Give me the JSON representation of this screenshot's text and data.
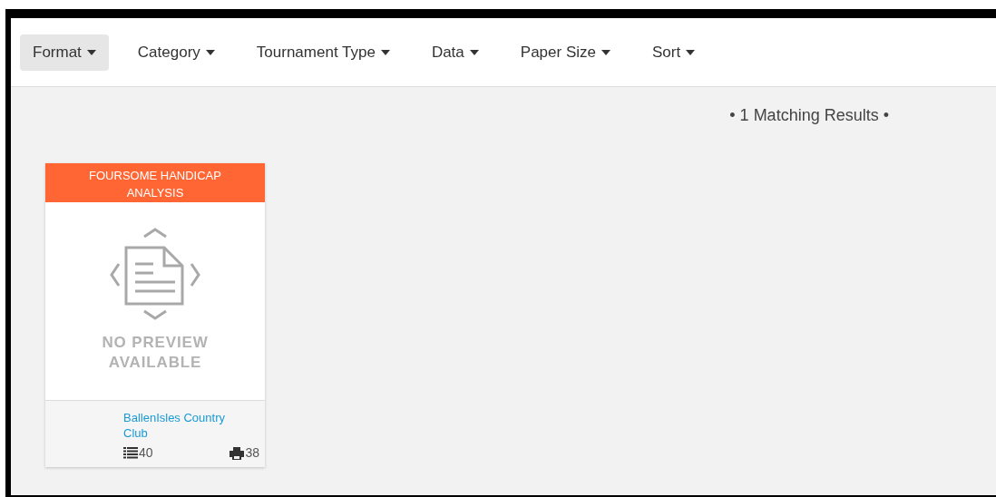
{
  "filters": [
    {
      "label": "Format",
      "selected": true
    },
    {
      "label": "Category",
      "selected": false
    },
    {
      "label": "Tournament Type",
      "selected": false
    },
    {
      "label": "Data",
      "selected": false
    },
    {
      "label": "Paper Size",
      "selected": false
    },
    {
      "label": "Sort",
      "selected": false
    }
  ],
  "results_summary": "• 1 Matching Results •",
  "cards": [
    {
      "title": "FOURSOME HANDICAP ANALYSIS",
      "preview": "NO PREVIEW AVAILABLE",
      "club": "BallenIsles Country Club",
      "list_count": "40",
      "print_count": "38"
    }
  ]
}
